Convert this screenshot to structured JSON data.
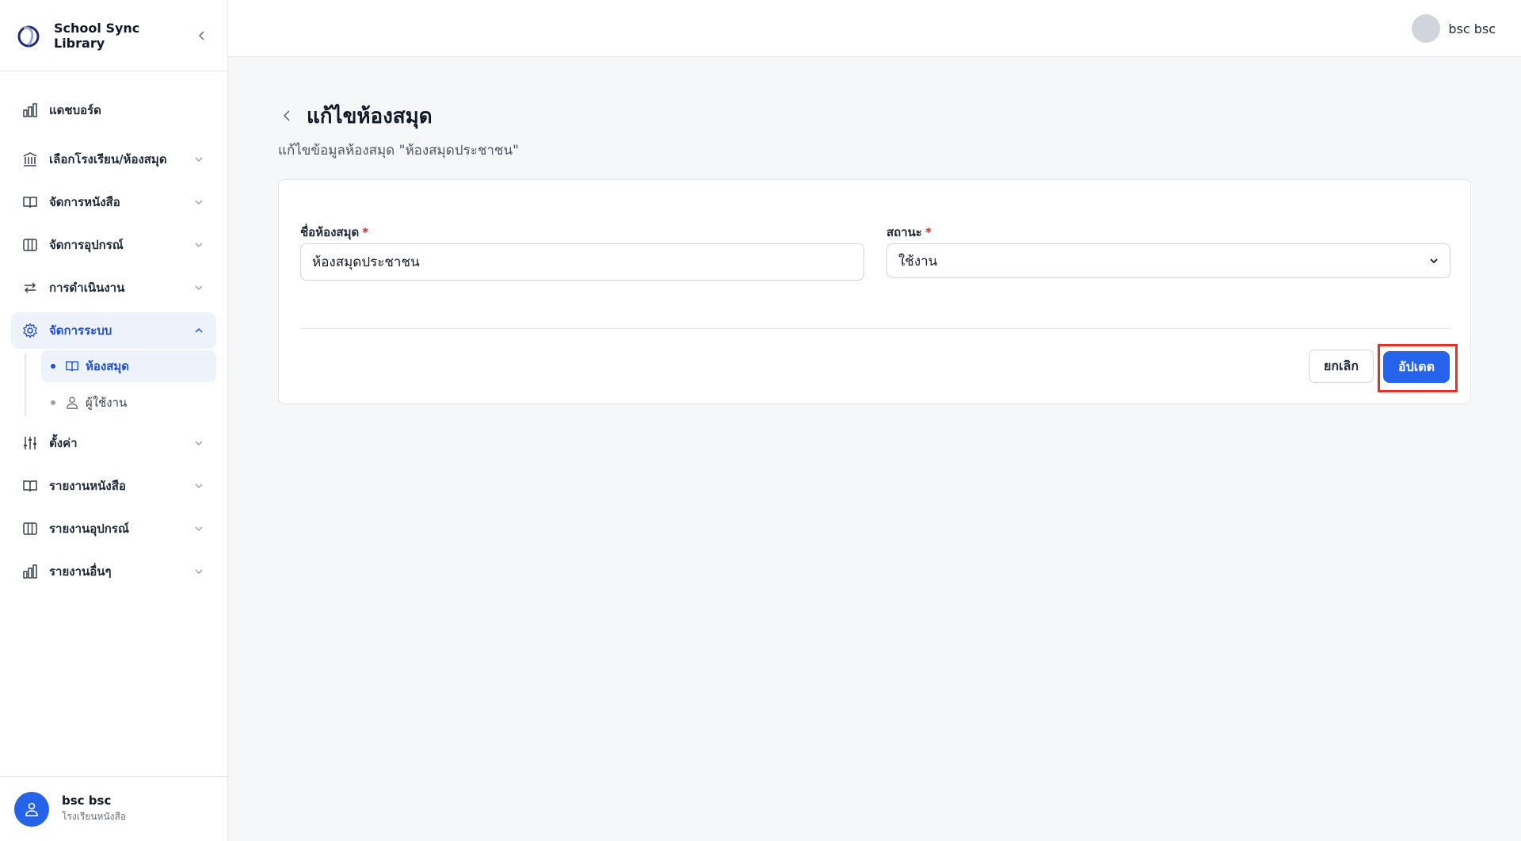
{
  "brand": {
    "name": "School Sync Library"
  },
  "sidebar": {
    "items": [
      {
        "label": "แดชบอร์ด",
        "icon": "bar-chart-icon"
      },
      {
        "label": "เลือกโรงเรียน/ห้องสมุด",
        "icon": "building-icon"
      },
      {
        "label": "จัดการหนังสือ",
        "icon": "book-open-icon"
      },
      {
        "label": "จัดการอุปกรณ์",
        "icon": "columns-icon"
      },
      {
        "label": "การดำเนินงาน",
        "icon": "arrows-exchange-icon"
      },
      {
        "label": "จัดการระบบ",
        "icon": "gear-icon",
        "active": true
      },
      {
        "label": "ตั้งค่า",
        "icon": "sliders-icon"
      },
      {
        "label": "รายงานหนังสือ",
        "icon": "book-open-icon"
      },
      {
        "label": "รายงานอุปกรณ์",
        "icon": "columns-icon"
      },
      {
        "label": "รายงานอื่นๆ",
        "icon": "bar-chart-icon"
      }
    ],
    "subitems": [
      {
        "label": "ห้องสมุด",
        "icon": "book-open-icon",
        "active": true
      },
      {
        "label": "ผู้ใช้งาน",
        "icon": "user-icon"
      }
    ],
    "footer": {
      "name": "bsc bsc",
      "org": "โรงเรียนหนังสือ"
    }
  },
  "topbar": {
    "user_name": "bsc bsc"
  },
  "page": {
    "title": "แก้ไขห้องสมุด",
    "subtitle": "แก้ไขข้อมูลห้องสมุด \"ห้องสมุดประชาชน\""
  },
  "form": {
    "name_label": "ชื่อห้องสมุด",
    "name_value": "ห้องสมุดประชาชน",
    "status_label": "สถานะ",
    "status_value": "ใช้งาน",
    "required_mark": "*",
    "cancel_label": "ยกเลิก",
    "update_label": "อัปเดต"
  },
  "colors": {
    "accent": "#2563eb",
    "active_bg": "#eef2fb",
    "highlight": "#ef2d1f",
    "required": "#dc2626"
  }
}
